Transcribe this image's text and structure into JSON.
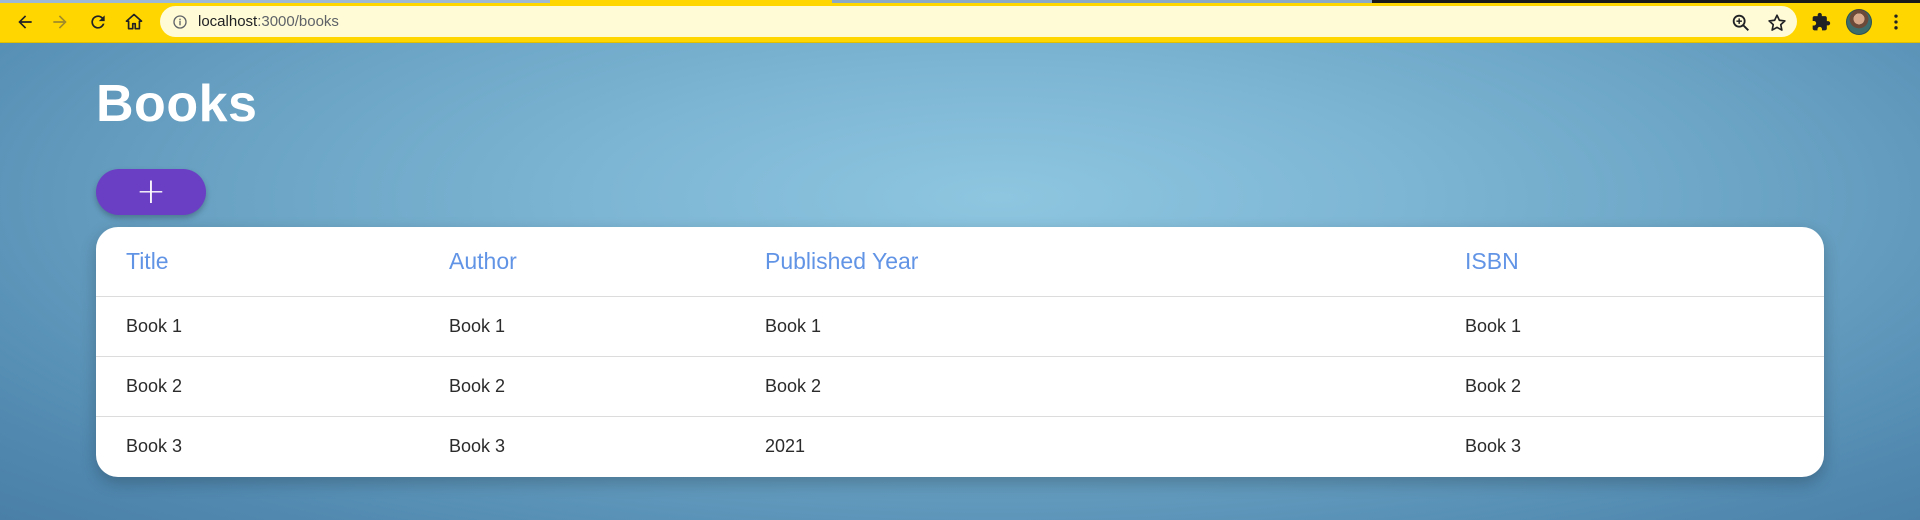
{
  "browser": {
    "url_host": "localhost",
    "url_path": ":3000/books",
    "accent_color": "#ffd600",
    "icons": [
      "back-arrow-icon",
      "forward-arrow-icon",
      "reload-icon",
      "home-icon",
      "site-info-icon",
      "zoom-icon",
      "bookmark-star-icon",
      "extensions-puzzle-icon",
      "profile-avatar",
      "more-vert-icon"
    ]
  },
  "page": {
    "title": "Books",
    "add_button_label": "+"
  },
  "table": {
    "columns": [
      "Title",
      "Author",
      "Published Year",
      "ISBN"
    ],
    "rows": [
      [
        "Book 1",
        "Book 1",
        "Book 1",
        "Book 1"
      ],
      [
        "Book 2",
        "Book 2",
        "Book 2",
        "Book 2"
      ],
      [
        "Book 3",
        "Book 3",
        "2021",
        "Book 3"
      ]
    ],
    "header_color": "#6294e6"
  },
  "colors": {
    "add_button": "#6a3fc3",
    "background": "#7db6d4"
  }
}
